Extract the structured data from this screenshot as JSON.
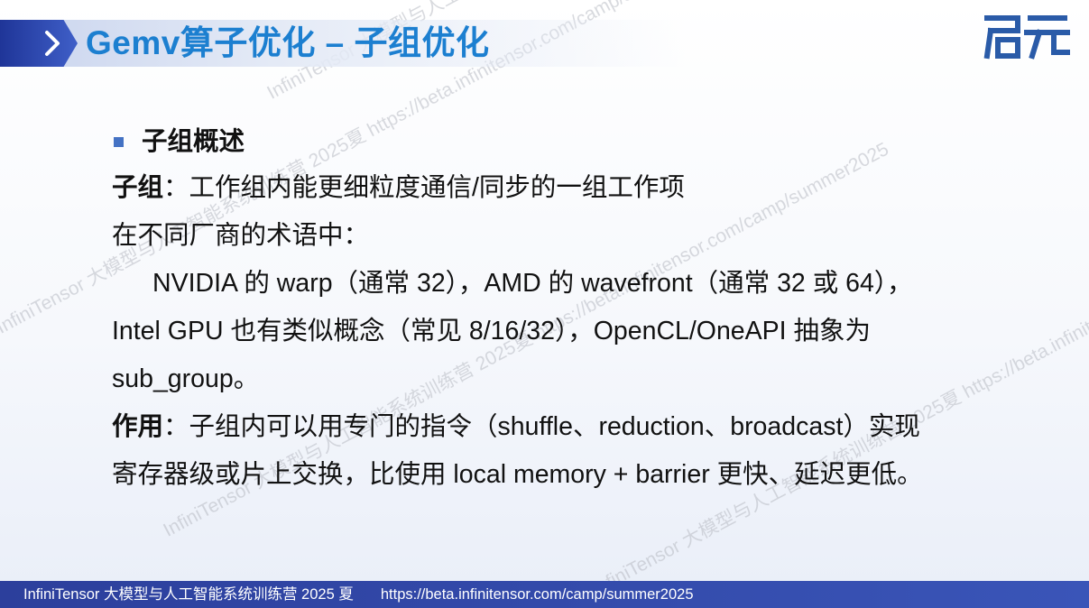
{
  "title": "Gemv算子优化 – 子组优化",
  "logo": {
    "text": "启元",
    "color": "#2a5ba8"
  },
  "section_heading": "子组概述",
  "paragraphs": {
    "subgroup_term": "子组",
    "subgroup_def": "：工作组内能更细粒度通信/同步的一组工作项",
    "vendor_intro": "在不同厂商的术语中：",
    "vendor_line1": "NVIDIA 的 warp（通常 32），AMD 的 wavefront（通常 32 或 64），",
    "vendor_line2": "Intel GPU 也有类似概念（常见 8/16/32），OpenCL/OneAPI 抽象为",
    "vendor_line3": "sub_group。",
    "effect_term": "作用",
    "effect_line1": "：子组内可以用专门的指令（shuffle、reduction、broadcast）实现",
    "effect_line2": "寄存器级或片上交换，比使用 local memory + barrier 更快、延迟更低。"
  },
  "watermark": "InfiniTensor 大模型与人工智能系统训练营 2025夏 https://beta.infinitensor.com/camp/summer2025",
  "footer": {
    "org": "InfiniTensor 大模型与人工智能系统训练营 2025 夏",
    "url": "https://beta.infinitensor.com/camp/summer2025"
  },
  "colors": {
    "title": "#1c7fd0",
    "bullet": "#4472c4",
    "footer_bg": "#2c3f9c",
    "title_tab": "#1f3598"
  }
}
